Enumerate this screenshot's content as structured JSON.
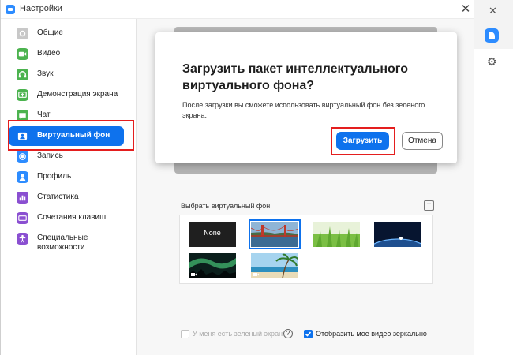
{
  "window": {
    "title": "Настройки",
    "close": "✕"
  },
  "sidebar": {
    "items": [
      {
        "label": "Общие",
        "icon": "gear-icon",
        "color": "#b9b9b9"
      },
      {
        "label": "Видео",
        "icon": "video-camera-icon",
        "color": "#4cb34f"
      },
      {
        "label": "Звук",
        "icon": "headphones-icon",
        "color": "#4cb34f"
      },
      {
        "label": "Демонстрация экрана",
        "icon": "share-screen-icon",
        "color": "#4cb34f"
      },
      {
        "label": "Чат",
        "icon": "chat-icon",
        "color": "#4cb34f"
      },
      {
        "label": "Виртуальный фон",
        "icon": "virtual-background-icon",
        "color": "#ffffff",
        "active": true
      },
      {
        "label": "Запись",
        "icon": "record-icon",
        "color": "#2d8cff"
      },
      {
        "label": "Профиль",
        "icon": "profile-icon",
        "color": "#2d8cff"
      },
      {
        "label": "Статистика",
        "icon": "statistics-icon",
        "color": "#8a4fd1"
      },
      {
        "label": "Сочетания клавиш",
        "icon": "keyboard-icon",
        "color": "#8a4fd1"
      },
      {
        "label": "Специальные возможности",
        "icon": "accessibility-icon",
        "color": "#8a4fd1"
      }
    ]
  },
  "dialog": {
    "title": "Загрузить пакет интеллектуального виртуального фона?",
    "text": "После загрузки вы сможете использовать виртуальный фон без зеленого экрана.",
    "download": "Загрузить",
    "cancel": "Отмена"
  },
  "backgrounds": {
    "label": "Выбрать виртуальный фон",
    "add": "+",
    "none_label": "None",
    "items": [
      "None",
      "golden-gate-bridge",
      "grass",
      "earth-from-space",
      "aurora-video",
      "beach-video"
    ],
    "selected": "golden-gate-bridge"
  },
  "options": {
    "green_screen": "У меня есть зеленый экран",
    "green_screen_checked": false,
    "mirror": "Отобразить мое видео зеркально",
    "mirror_checked": true
  },
  "accent": "#0e72ed",
  "highlight": "#e41e1e"
}
